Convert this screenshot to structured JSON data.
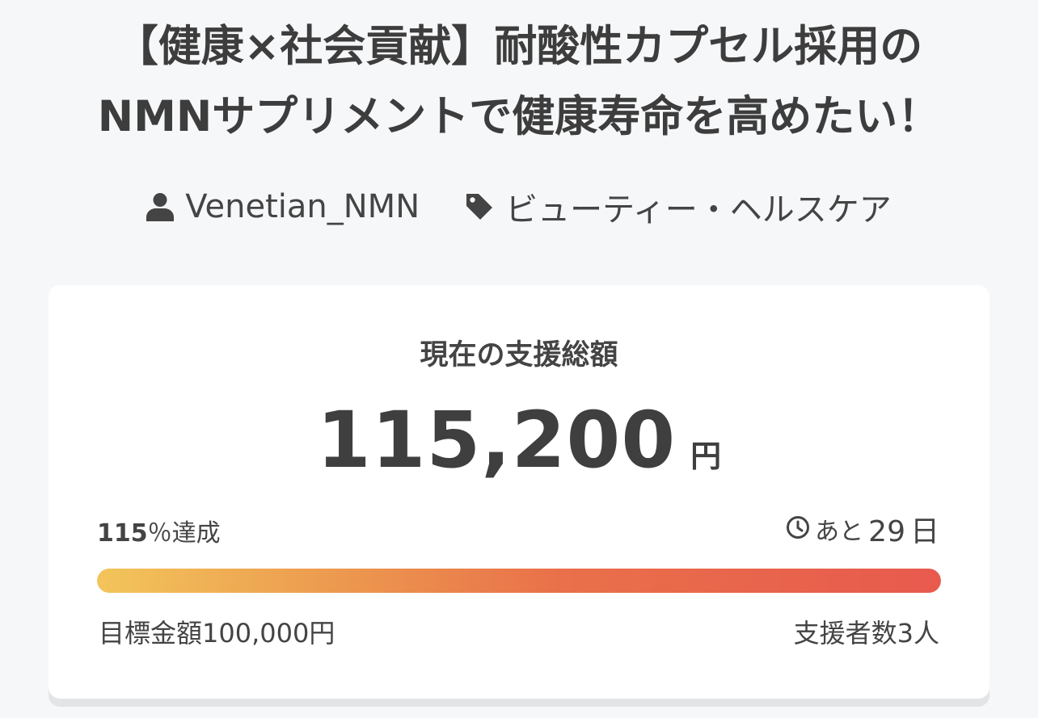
{
  "project": {
    "title_line1": "【健康×社会貢献】耐酸性カプセル採用の",
    "title_line2": "NMNサプリメントで健康寿命を高めたい！"
  },
  "meta": {
    "author": "Venetian_NMN",
    "author_icon": "user-icon",
    "category": "ビューティー・ヘルスケア",
    "category_icon": "tag-icon"
  },
  "funding": {
    "label": "現在の支援総額",
    "amount": "115,200",
    "currency": "円",
    "achieved_percent": "115",
    "achieved_suffix": "％達成",
    "progress_fraction": 1.0,
    "remaining_prefix": "あと",
    "remaining_days": "29",
    "remaining_unit": "日",
    "remaining_icon": "clock-icon",
    "goal": "目標金額100,000円",
    "backers": "支援者数3人"
  },
  "colors": {
    "background": "#f6f7f9",
    "card": "#ffffff",
    "text": "#3c3c3c",
    "progress_start": "#f3c55b",
    "progress_end": "#e85a4e"
  }
}
